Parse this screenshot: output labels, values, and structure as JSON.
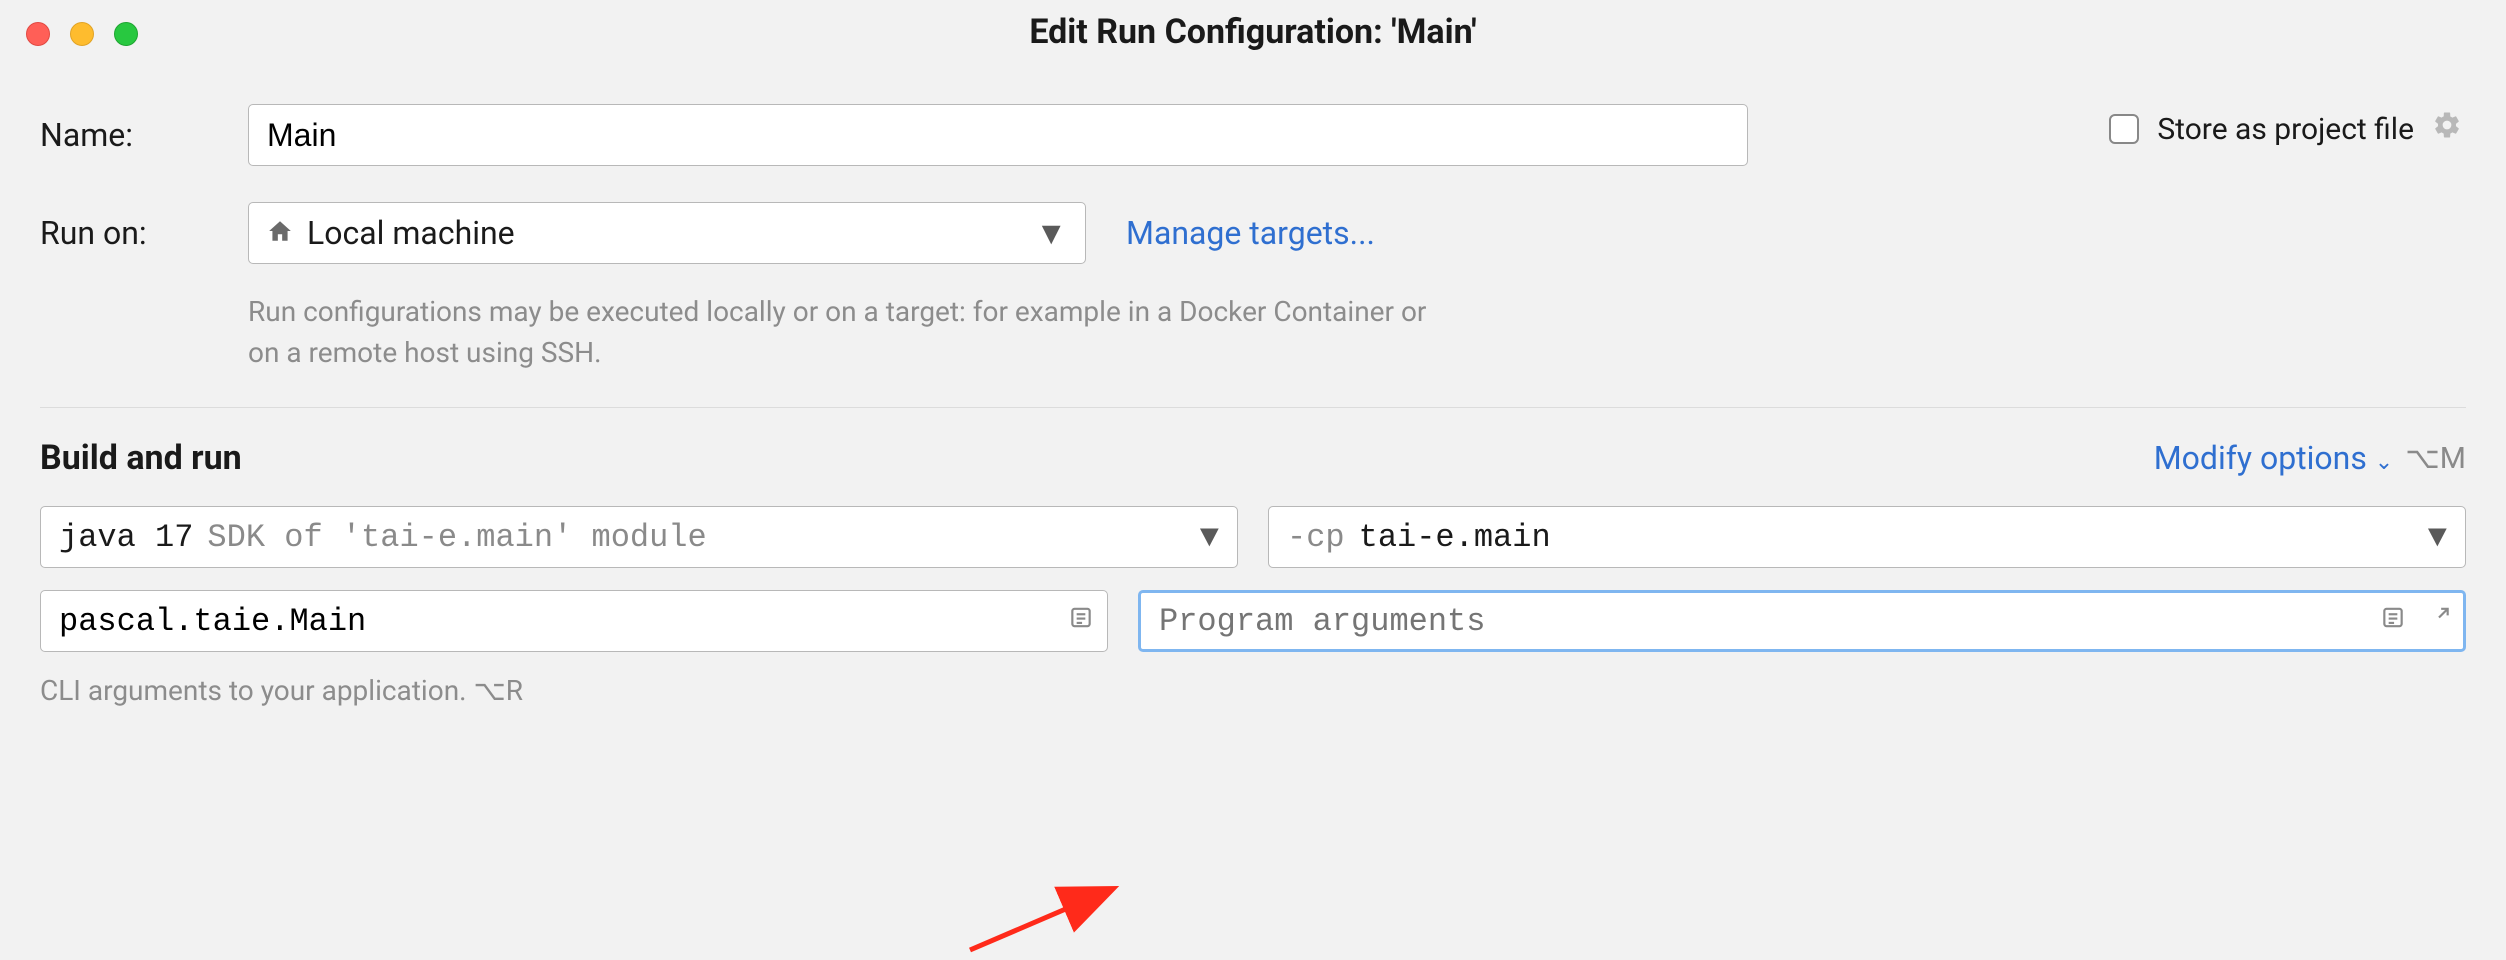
{
  "window": {
    "title": "Edit Run Configuration: 'Main'"
  },
  "name_row": {
    "label": "Name:",
    "value": "Main"
  },
  "store_checkbox": {
    "label": "Store as project file"
  },
  "run_on": {
    "label": "Run on:",
    "value": "Local machine",
    "manage_link": "Manage targets...",
    "help": "Run configurations may be executed locally or on a target: for example in a Docker Container or on a remote host using SSH."
  },
  "build_run": {
    "title": "Build and run",
    "modify_options": "Modify options",
    "modify_shortcut": "⌥M",
    "sdk": {
      "value": "java 17",
      "hint": "SDK of 'tai-e.main' module"
    },
    "classpath": {
      "prefix": "-cp",
      "value": "tai-e.main"
    },
    "main_class": "pascal.taie.Main",
    "program_args_placeholder": "Program arguments",
    "cli_help": "CLI arguments to your application.",
    "cli_shortcut": "⌥R"
  }
}
